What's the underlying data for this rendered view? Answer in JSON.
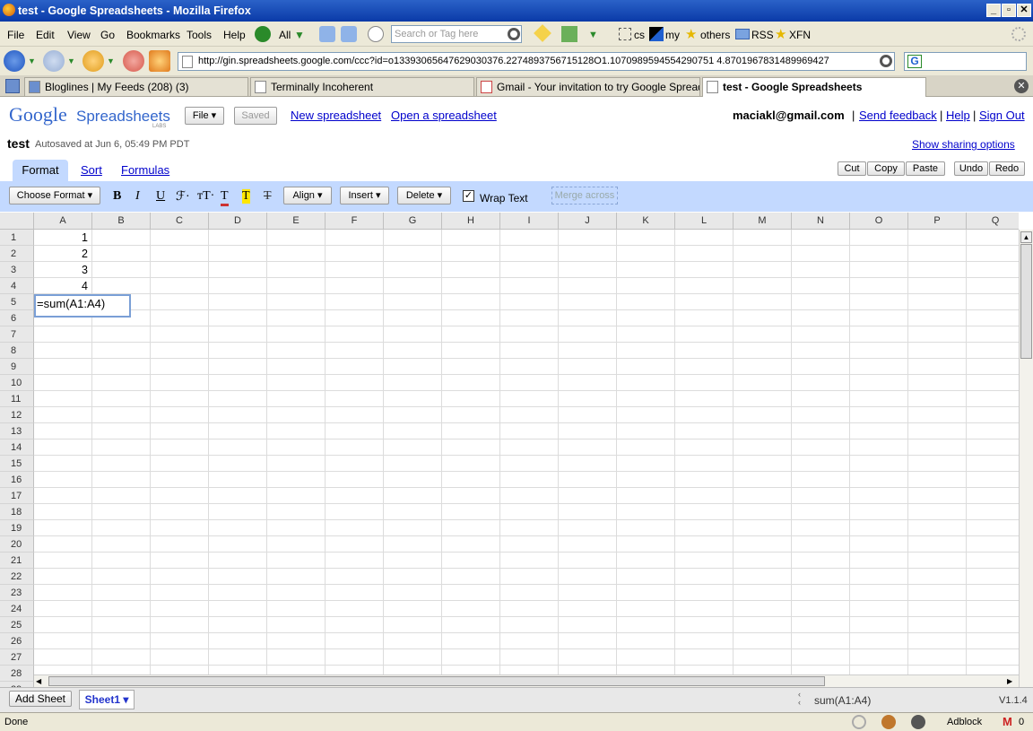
{
  "window": {
    "title": "test - Google Spreadsheets - Mozilla Firefox"
  },
  "menu": {
    "items": [
      "File",
      "Edit",
      "View",
      "Go",
      "Bookmarks",
      "Tools",
      "Help"
    ]
  },
  "toolbar": {
    "all_label": "All",
    "search_placeholder": "Search or Tag here",
    "bm_cs": "cs",
    "bm_my": "my",
    "bm_others": "others",
    "bm_rss": "RSS",
    "bm_xfn": "XFN"
  },
  "url": "http://gin.spreadsheets.google.com/ccc?id=o13393065647629030376.2274893756715128O1.1070989594554290751 4.8701967831489969427",
  "tabs": [
    {
      "label": "Bloglines | My Feeds (208) (3)"
    },
    {
      "label": "Terminally Incoherent"
    },
    {
      "label": "Gmail - Your invitation to try Google Spread..."
    },
    {
      "label": "test - Google Spreadsheets"
    }
  ],
  "app": {
    "logo_google": "Google",
    "logo_product": "Spreadsheets",
    "logo_labs": "LABS",
    "file_btn": "File ▾",
    "saved_btn": "Saved",
    "new_link": "New spreadsheet",
    "open_link": "Open a spreadsheet",
    "user": "maciakl@gmail.com",
    "sep": "|",
    "feedback": "Send feedback",
    "help": "Help",
    "signout": "Sign Out",
    "doc_title": "test",
    "autosave": "Autosaved at Jun 6, 05:49 PM PDT",
    "sharing": "Show sharing options"
  },
  "tabsrow": {
    "format": "Format",
    "sort": "Sort",
    "formulas": "Formulas",
    "cut": "Cut",
    "copy": "Copy",
    "paste": "Paste",
    "undo": "Undo",
    "redo": "Redo"
  },
  "fmtbar": {
    "choose": "Choose Format ▾",
    "bold": "B",
    "italic": "I",
    "underline": "U",
    "font": "ℱ·",
    "size": "тT·",
    "color": "T",
    "bg": "T",
    "clear": "T",
    "align": "Align ▾",
    "insert": "Insert ▾",
    "delete": "Delete ▾",
    "wrap": "Wrap Text",
    "merge": "Merge across"
  },
  "columns": [
    "A",
    "B",
    "C",
    "D",
    "E",
    "F",
    "G",
    "H",
    "I",
    "J",
    "K",
    "L",
    "M",
    "N",
    "O",
    "P",
    "Q"
  ],
  "rows": [
    "1",
    "2",
    "3",
    "4",
    "5",
    "6",
    "7",
    "8",
    "9",
    "10",
    "11",
    "12",
    "13",
    "14",
    "15",
    "16",
    "17",
    "18",
    "19",
    "20",
    "21",
    "22",
    "23",
    "24",
    "25",
    "26",
    "27",
    "28",
    "29"
  ],
  "cells": {
    "A1": "1",
    "A2": "2",
    "A3": "3",
    "A4": "4"
  },
  "editing": {
    "cell": "A5",
    "value": "=sum(A1:A4)"
  },
  "bottom": {
    "add_sheet": "Add Sheet",
    "sheet1": "Sheet1 ▾",
    "formula": "sum(A1:A4)",
    "version": "V1.1.4"
  },
  "status": {
    "text": "Done",
    "adblock": "Adblock",
    "gmail_count": "0"
  }
}
